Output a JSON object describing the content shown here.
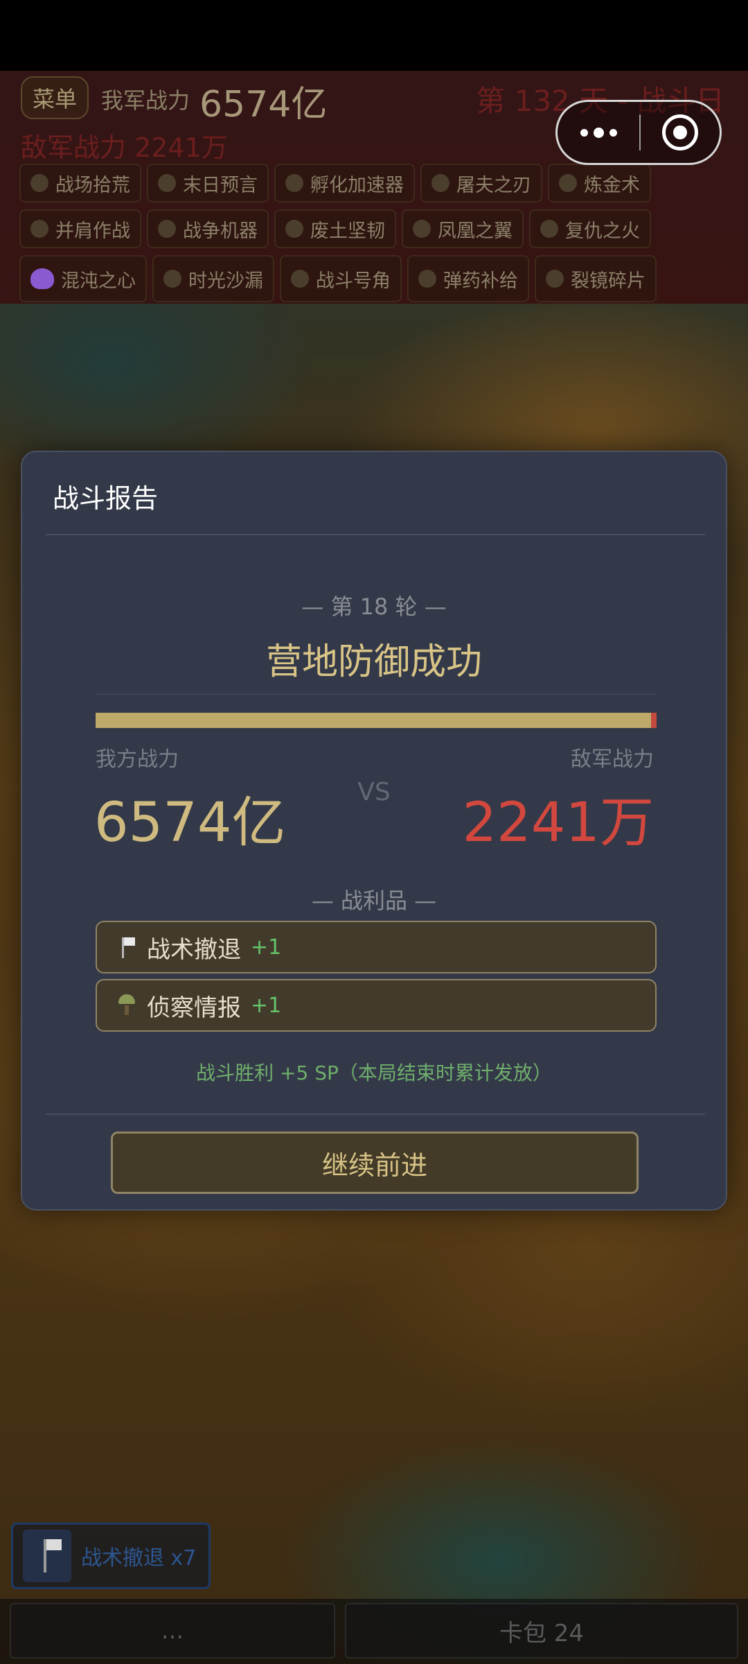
{
  "hud": {
    "menu_label": "菜单",
    "my_power_label": "我军战力",
    "my_power_value": "6574亿",
    "day_label": "第 132 天 - 战斗日",
    "enemy_power": "敌军战力 2241万",
    "chip_rows": [
      [
        "战场拾荒",
        "末日预言",
        "孵化加速器",
        "屠夫之刃",
        "炼金术"
      ],
      [
        "并肩作战",
        "战争机器",
        "废土坚韧",
        "凤凰之翼",
        "复仇之火"
      ],
      [
        "混沌之心",
        "时光沙漏",
        "战斗号角",
        "弹药补给",
        "裂镜碎片"
      ]
    ]
  },
  "capsule": {
    "more_icon": "more-dots-icon",
    "close_icon": "target-close-icon"
  },
  "report": {
    "title": "战斗报告",
    "round_label": "— 第 18 轮 —",
    "result": "营地防御成功",
    "my_side_label": "我方战力",
    "enemy_side_label": "敌军战力",
    "vs": "VS",
    "my_power": "6574亿",
    "enemy_power": "2241万",
    "my_power_share": 0.99,
    "loot_header": "— 战利品 —",
    "loot": [
      {
        "name": "战术撤退",
        "count": "+1",
        "icon": "flag-icon"
      },
      {
        "name": "侦察情报",
        "count": "+1",
        "icon": "parachute-icon"
      }
    ],
    "victory_note": "战斗胜利 +5 SP（本局结束时累计发放）",
    "continue_label": "继续前进"
  },
  "bottom": {
    "retreat_card_label": "战术撤退 x7",
    "left_button_label": "...",
    "card_pack_label": "卡包 24"
  },
  "colors": {
    "modal_bg": "#333949",
    "accent_gold": "#cfba80",
    "enemy_red": "#d2473e",
    "loot_green": "#66c46a"
  }
}
